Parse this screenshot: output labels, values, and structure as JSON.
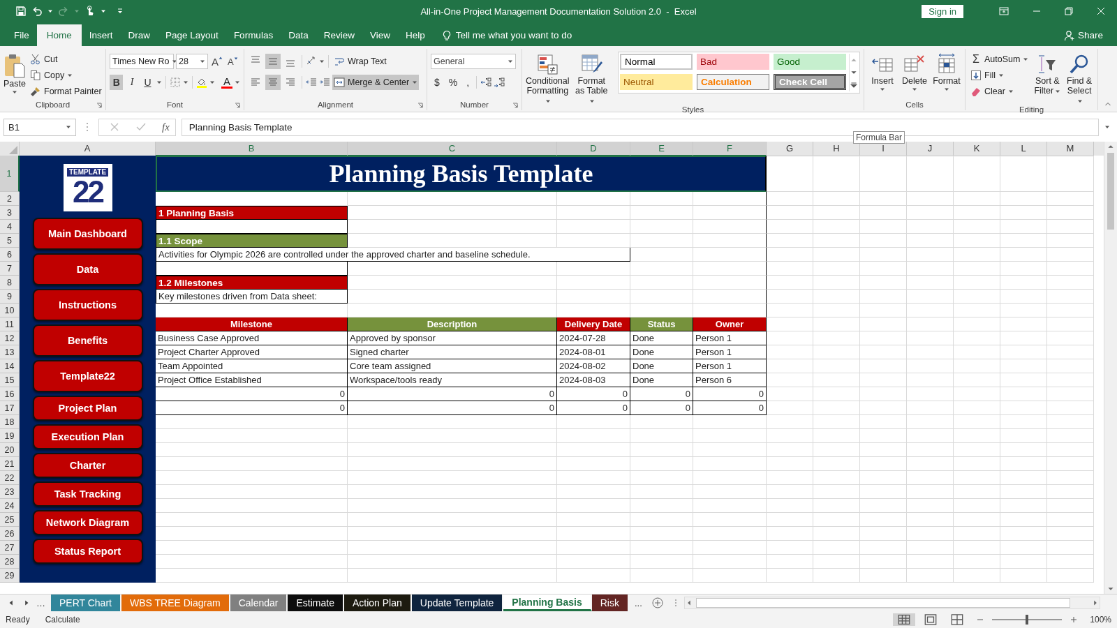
{
  "window": {
    "title": "All-in-One Project Management Documentation Solution 2.0  -  Excel",
    "sign_in": "Sign in"
  },
  "menu_tabs": [
    {
      "label": "File",
      "selected": false
    },
    {
      "label": "Home",
      "selected": true
    },
    {
      "label": "Insert",
      "selected": false
    },
    {
      "label": "Draw",
      "selected": false
    },
    {
      "label": "Page Layout",
      "selected": false
    },
    {
      "label": "Formulas",
      "selected": false
    },
    {
      "label": "Data",
      "selected": false
    },
    {
      "label": "Review",
      "selected": false
    },
    {
      "label": "View",
      "selected": false
    },
    {
      "label": "Help",
      "selected": false
    }
  ],
  "tell_me": "Tell me what you want to do",
  "share": "Share",
  "ribbon": {
    "clipboard": {
      "paste": "Paste",
      "cut": "Cut",
      "copy": "Copy",
      "format_painter": "Format Painter",
      "label": "Clipboard"
    },
    "font": {
      "name": "Times New Ro",
      "size": "28",
      "grow": "A",
      "shrink": "A",
      "styles": [
        {
          "glyph": "B",
          "selected": true
        },
        {
          "glyph": "I",
          "selected": false
        },
        {
          "glyph": "U",
          "selected": false
        }
      ],
      "color_glyph": "A",
      "label": "Font"
    },
    "alignment": {
      "vertical": [
        {
          "selected": false
        },
        {
          "selected": true
        },
        {
          "selected": false
        }
      ],
      "horizontal": [
        {
          "selected": false
        },
        {
          "selected": true
        },
        {
          "selected": false
        }
      ],
      "wrap_text": {
        "label": "Wrap Text",
        "selected": false
      },
      "merge": {
        "label": "Merge & Center",
        "selected": true
      },
      "label": "Alignment"
    },
    "number": {
      "format": "General",
      "symbols": [
        "$",
        "%",
        ","
      ],
      "label": "Number"
    },
    "styles": {
      "conditional": "Conditional Formatting",
      "format_table": "Format as Table",
      "gallery": [
        {
          "label": "Normal",
          "kind": "normal"
        },
        {
          "label": "Bad",
          "kind": "bad"
        },
        {
          "label": "Good",
          "kind": "good"
        },
        {
          "label": "Neutral",
          "kind": "neutral"
        },
        {
          "label": "Calculation",
          "kind": "calculation"
        },
        {
          "label": "Check Cell",
          "kind": "check"
        }
      ],
      "label": "Styles"
    },
    "cells": {
      "buttons": [
        {
          "label": "Insert",
          "kind": "insert"
        },
        {
          "label": "Delete",
          "kind": "delete"
        },
        {
          "label": "Format",
          "kind": "format"
        }
      ],
      "label": "Cells"
    },
    "editing": {
      "sigma": "Σ",
      "autosum": "AutoSum",
      "fill": "Fill",
      "clear": "Clear",
      "sort": "Sort & Filter",
      "find": "Find & Select",
      "label": "Editing"
    }
  },
  "formula_bar": {
    "name_box": "B1",
    "fx": "fx",
    "formula": "Planning Basis Template",
    "tooltip": "Formula Bar"
  },
  "sheet": {
    "columns": [
      {
        "label": "A",
        "selected": false
      },
      {
        "label": "B",
        "selected": true
      },
      {
        "label": "C",
        "selected": true
      },
      {
        "label": "D",
        "selected": true
      },
      {
        "label": "E",
        "selected": true
      },
      {
        "label": "F",
        "selected": true
      },
      {
        "label": "G",
        "selected": false
      },
      {
        "label": "H",
        "selected": false
      },
      {
        "label": "I",
        "selected": false
      },
      {
        "label": "J",
        "selected": false
      },
      {
        "label": "K",
        "selected": false
      },
      {
        "label": "L",
        "selected": false
      },
      {
        "label": "M",
        "selected": false
      }
    ],
    "logo": {
      "word": "TEMPLATE",
      "number": "22"
    },
    "nav_buttons": [
      "Main Dashboard",
      "Data",
      "Instructions",
      "Benefits",
      "Template22",
      "Project Plan",
      "Execution Plan",
      "Charter",
      "Task Tracking",
      "Network Diagram",
      "Status Report"
    ],
    "rows": [
      {
        "number": "1",
        "selected": true,
        "kind": "title",
        "text": "Planning Basis Template"
      },
      {
        "number": "2",
        "selected": false,
        "kind": "gap"
      },
      {
        "number": "3",
        "selected": false,
        "kind": "section",
        "text": "1 Planning Basis"
      },
      {
        "number": "4",
        "selected": false,
        "kind": "boxed"
      },
      {
        "number": "5",
        "selected": false,
        "kind": "subsection",
        "text": "1.1 Scope"
      },
      {
        "number": "6",
        "selected": false,
        "kind": "wide-text",
        "text": "Activities for Olympic 2026 are controlled under the approved charter and baseline schedule."
      },
      {
        "number": "7",
        "selected": false,
        "kind": "boxed"
      },
      {
        "number": "8",
        "selected": false,
        "kind": "section",
        "text": "1.2 Milestones"
      },
      {
        "number": "9",
        "selected": false,
        "kind": "boxed-text",
        "text": "Key milestones driven from Data sheet:"
      },
      {
        "number": "10",
        "selected": false,
        "kind": "gap"
      },
      {
        "number": "11",
        "selected": false,
        "kind": "header",
        "cells": [
          {
            "text": "Milestone",
            "color": "#c00000"
          },
          {
            "text": "Description",
            "color": "#76923c"
          },
          {
            "text": "Delivery Date",
            "color": "#c00000"
          },
          {
            "text": "Status",
            "color": "#76923c"
          },
          {
            "text": "Owner",
            "color": "#c00000"
          }
        ]
      },
      {
        "number": "12",
        "selected": false,
        "kind": "data",
        "cells": [
          "Business Case Approved",
          "Approved by sponsor",
          "2024-07-28",
          "Done",
          "Person 1"
        ]
      },
      {
        "number": "13",
        "selected": false,
        "kind": "data",
        "cells": [
          "Project Charter Approved",
          "Signed charter",
          "2024-08-01",
          "Done",
          "Person 1"
        ]
      },
      {
        "number": "14",
        "selected": false,
        "kind": "data",
        "cells": [
          "Team Appointed",
          "Core team assigned",
          "2024-08-02",
          "Done",
          "Person 1"
        ]
      },
      {
        "number": "15",
        "selected": false,
        "kind": "data",
        "cells": [
          "Project Office Established",
          "Workspace/tools ready",
          "2024-08-03",
          "Done",
          "Person 6"
        ]
      },
      {
        "number": "16",
        "selected": false,
        "kind": "numbers",
        "cells": [
          "0",
          "0",
          "0",
          "0",
          "0"
        ]
      },
      {
        "number": "17",
        "selected": false,
        "kind": "numbers",
        "cells": [
          "0",
          "0",
          "0",
          "0",
          "0"
        ]
      },
      {
        "number": "18",
        "selected": false,
        "kind": "blank"
      },
      {
        "number": "19",
        "selected": false,
        "kind": "blank"
      },
      {
        "number": "20",
        "selected": false,
        "kind": "blank"
      },
      {
        "number": "21",
        "selected": false,
        "kind": "blank"
      },
      {
        "number": "22",
        "selected": false,
        "kind": "blank"
      },
      {
        "number": "23",
        "selected": false,
        "kind": "blank"
      },
      {
        "number": "24",
        "selected": false,
        "kind": "blank"
      },
      {
        "number": "25",
        "selected": false,
        "kind": "blank"
      },
      {
        "number": "26",
        "selected": false,
        "kind": "blank"
      },
      {
        "number": "27",
        "selected": false,
        "kind": "blank"
      },
      {
        "number": "28",
        "selected": false,
        "kind": "blank"
      },
      {
        "number": "29",
        "selected": false,
        "kind": "blank"
      }
    ]
  },
  "sheet_tabs": {
    "more_left": "…",
    "tabs": [
      {
        "label": "PERT Chart",
        "color": "#31869b",
        "selected": false
      },
      {
        "label": "WBS TREE Diagram",
        "color": "#e26b0a",
        "selected": false
      },
      {
        "label": "Calendar",
        "color": "#808080",
        "selected": false
      },
      {
        "label": "Estimate",
        "color": "#0d0d0d",
        "selected": false
      },
      {
        "label": "Action Plan",
        "color": "#1d1b10",
        "selected": false
      },
      {
        "label": "Update Template",
        "color": "#0f243e",
        "selected": false
      },
      {
        "label": "Planning Basis",
        "color": "#217346",
        "selected": true
      },
      {
        "label": "Risk",
        "color": "#632523",
        "selected": false
      }
    ],
    "more_right": "..."
  },
  "status_bar": {
    "mode": "Ready",
    "calculate": "Calculate",
    "zoom": "100%",
    "level": 0.5
  }
}
